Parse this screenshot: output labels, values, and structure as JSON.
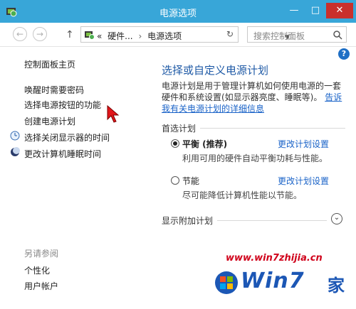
{
  "window": {
    "title": "电源选项",
    "min_glyph": "—",
    "max_glyph": "□",
    "close_glyph": "✕"
  },
  "toolbar": {
    "back_glyph": "←",
    "forward_glyph": "→",
    "up_glyph": "↑",
    "breadcrumb": [
      "«",
      "硬件...",
      "›",
      "电源选项"
    ],
    "dropdown_glyph": "▼",
    "refresh_glyph": "↻",
    "search_placeholder": "搜索控制面板"
  },
  "help_glyph": "?",
  "sidebar": {
    "home": "控制面板主页",
    "links": [
      "唤醒时需要密码",
      "选择电源按钮的功能",
      "创建电源计划",
      "选择关闭显示器的时间",
      "更改计算机睡眠时间"
    ],
    "see_also_header": "另请参阅",
    "see_also": [
      "个性化",
      "用户帐户"
    ]
  },
  "main": {
    "title": "选择或自定义电源计划",
    "description": "电源计划是用于管理计算机如何使用电源的一套硬件和系统设置(如显示器亮度、睡眠等)。",
    "description_link": "告诉我有关电源计划的详细信息",
    "preferred_header": "首选计划",
    "plans": [
      {
        "name": "平衡 (推荐)",
        "change": "更改计划设置",
        "desc": "利用可用的硬件自动平衡功耗与性能。",
        "selected": true
      },
      {
        "name": "节能",
        "change": "更改计划设置",
        "desc": "尽可能降低计算机性能以节能。",
        "selected": false
      }
    ],
    "additional_header": "显示附加计划",
    "expand_glyph": "⌄"
  },
  "watermark": {
    "site": "www.win7zhijia.cn",
    "logo": "Win7",
    "logo_suffix": "家"
  },
  "colors": {
    "titlebar": "#38a6d8",
    "link": "#1a63c8",
    "heading": "#1f5aa6",
    "close": "#c9302c"
  }
}
